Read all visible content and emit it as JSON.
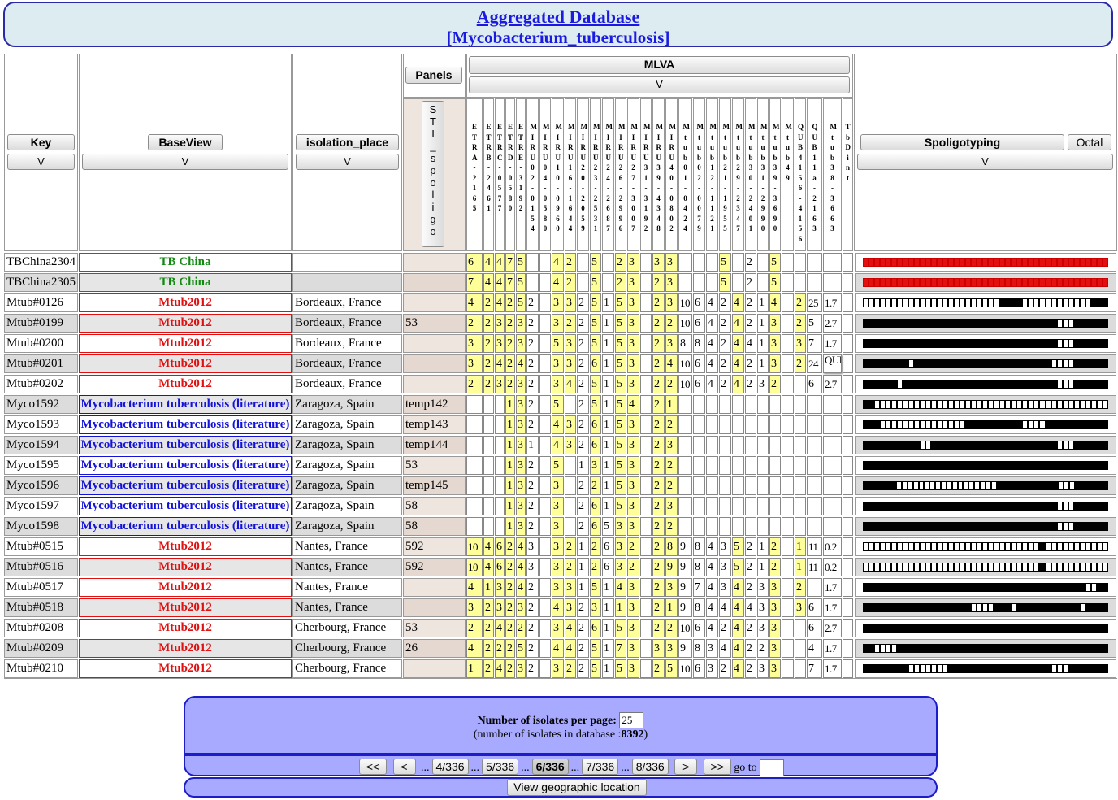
{
  "header": {
    "title": "Aggregated Database",
    "subtitle": "[Mycobacterium_tuberculosis]"
  },
  "columns": {
    "key": "Key",
    "baseview": "BaseView",
    "isolation_place": "isolation_place",
    "panels": "Panels",
    "mlva": "MLVA",
    "spoligotyping": "Spoligotyping",
    "octal": "Octal",
    "sort": "V",
    "sit_spoligo": [
      "S",
      "T",
      "I",
      "_",
      "s",
      "p",
      "o",
      "l",
      "i",
      "g",
      "o"
    ]
  },
  "mlva_headers": [
    "ETRA-2165",
    "ETRB-2461",
    "ETRC-0577",
    "ETRD-0580",
    "ETRE-3192",
    "MIRU02-0154",
    "MIRU04-0580",
    "MIRU10-0960",
    "MIRU16-1644",
    "MIRU20-2059",
    "MIRU23-2531",
    "MIRU24-2687",
    "MIRU26-2996",
    "MIRU27-3007",
    "MIRU31-3192",
    "MIRU39-4348",
    "MIRU40-0802",
    "Mtub01-0424",
    "Mtub02-0079",
    "Mtub12-1121",
    "Mtub21-1955",
    "Mtub29-2347",
    "Mtub30-2401",
    "Mtub31-2990",
    "Mtub39-3690",
    "Mtub49",
    "QUB4156-4156",
    "QUB11a-2163",
    "Mtub38-3663",
    "TbDint"
  ],
  "rows": [
    {
      "key": "TBChina2304",
      "base": "TB China",
      "color": "#128a12",
      "place": "",
      "panel": "",
      "mlva": [
        "6",
        "4",
        "4",
        "7",
        "5",
        "",
        "",
        "4",
        "2",
        "",
        "5",
        "",
        "2",
        "3",
        "",
        "3",
        "3",
        "",
        "",
        "",
        "5",
        "",
        "2",
        "",
        "5",
        "",
        "",
        "",
        "",
        ""
      ],
      "spoligo": "rrrrrrrrrrrrrrrrrrrrrrrrrrrrrrrrrrrrrrrrrrr"
    },
    {
      "key": "TBChina2305",
      "base": "TB China",
      "color": "#128a12",
      "place": "",
      "panel": "",
      "mlva": [
        "7",
        "4",
        "4",
        "7",
        "5",
        "",
        "",
        "4",
        "2",
        "",
        "5",
        "",
        "2",
        "3",
        "",
        "2",
        "3",
        "",
        "",
        "",
        "5",
        "",
        "2",
        "",
        "5",
        "",
        "",
        "",
        "",
        ""
      ],
      "spoligo": "rrrrrrrrrrrrrrrrrrrrrrrrrrrrrrrrrrrrrrrrrrr"
    },
    {
      "key": "Mtub#0126",
      "base": "Mtub2012",
      "color": "#e01010",
      "place": "Bordeaux, France",
      "panel": "",
      "mlva": [
        "4",
        "2",
        "4",
        "2",
        "5",
        "2",
        "",
        "3",
        "3",
        "2",
        "5",
        "1",
        "5",
        "3",
        "",
        "2",
        "3",
        "10",
        "6",
        "4",
        "2",
        "4",
        "2",
        "1",
        "4",
        "",
        "2",
        "25",
        "1.7",
        ""
      ],
      "spoligo": "eeeeeeeeeeeeeeeeeeeeeeeeffffeeeeeeeeeeeefff"
    },
    {
      "key": "Mtub#0199",
      "base": "Mtub2012",
      "color": "#e01010",
      "place": "Bordeaux, France",
      "panel": "53",
      "mlva": [
        "2",
        "2",
        "3",
        "2",
        "3",
        "2",
        "",
        "3",
        "2",
        "2",
        "5",
        "1",
        "5",
        "3",
        "",
        "2",
        "2",
        "10",
        "6",
        "4",
        "2",
        "4",
        "2",
        "1",
        "3",
        "",
        "2",
        "5",
        "2.7",
        ""
      ],
      "spoligo": "ffffffffffffffffffffffffffffffffffeeeffffff"
    },
    {
      "key": "Mtub#0200",
      "base": "Mtub2012",
      "color": "#e01010",
      "place": "Bordeaux, France",
      "panel": "",
      "mlva": [
        "3",
        "2",
        "3",
        "2",
        "3",
        "2",
        "",
        "5",
        "3",
        "2",
        "5",
        "1",
        "5",
        "3",
        "",
        "2",
        "3",
        "8",
        "8",
        "4",
        "2",
        "4",
        "4",
        "1",
        "3",
        "",
        "3",
        "7",
        "1.7",
        ""
      ],
      "spoligo": "ffffffffffffffffffffffffffffffffffeeeffffff"
    },
    {
      "key": "Mtub#0201",
      "base": "Mtub2012",
      "color": "#e01010",
      "place": "Bordeaux, France",
      "panel": "",
      "mlva": [
        "3",
        "2",
        "4",
        "2",
        "4",
        "2",
        "",
        "3",
        "3",
        "2",
        "6",
        "1",
        "5",
        "3",
        "",
        "2",
        "4",
        "10",
        "6",
        "4",
        "2",
        "4",
        "2",
        "1",
        "3",
        "",
        "2",
        "24",
        "QUE",
        ""
      ],
      "spoligo": "ffffffffeffffffffffffffffffffffffeeeeffffff"
    },
    {
      "key": "Mtub#0202",
      "base": "Mtub2012",
      "color": "#e01010",
      "place": "Bordeaux, France",
      "panel": "",
      "mlva": [
        "2",
        "2",
        "3",
        "2",
        "3",
        "2",
        "",
        "3",
        "4",
        "2",
        "5",
        "1",
        "5",
        "3",
        "",
        "2",
        "2",
        "10",
        "6",
        "4",
        "2",
        "4",
        "2",
        "3",
        "2",
        "",
        "",
        "6",
        "2.7",
        ""
      ],
      "spoligo": "ffffffefffffffffffffffffffffffffffeeeffffff"
    },
    {
      "key": "Myco1592",
      "base": "Mycobacterium tuberculosis (literature)",
      "color": "#1212d8",
      "place": "Zaragoza, Spain",
      "panel": "temp142",
      "mlva": [
        "",
        "",
        "",
        "1",
        "3",
        "2",
        "",
        "5",
        "",
        "2",
        "5",
        "1",
        "5",
        "4",
        "",
        "2",
        "1",
        "",
        "",
        "",
        "",
        "",
        "",
        "",
        "",
        "",
        "",
        "",
        "",
        ""
      ],
      "spoligo": "ffeeeeeeeeeeeeeeeeeeeeeeeeeeeeeeeeeeeeeeeee"
    },
    {
      "key": "Myco1593",
      "base": "Mycobacterium tuberculosis (literature)",
      "color": "#1212d8",
      "place": "Zaragoza, Spain",
      "panel": "temp143",
      "mlva": [
        "",
        "",
        "",
        "1",
        "3",
        "2",
        "",
        "4",
        "3",
        "2",
        "6",
        "1",
        "5",
        "3",
        "",
        "2",
        "2",
        "",
        "",
        "",
        "",
        "",
        "",
        "",
        "",
        "",
        "",
        "",
        "",
        ""
      ],
      "spoligo": "fffeeeeeeeeeeeeeeeffffffffffeeeefffffffffff"
    },
    {
      "key": "Myco1594",
      "base": "Mycobacterium tuberculosis (literature)",
      "color": "#1212d8",
      "place": "Zaragoza, Spain",
      "panel": "temp144",
      "mlva": [
        "",
        "",
        "",
        "1",
        "3",
        "1",
        "",
        "4",
        "3",
        "2",
        "6",
        "1",
        "5",
        "3",
        "",
        "2",
        "3",
        "",
        "",
        "",
        "",
        "",
        "",
        "",
        "",
        "",
        "",
        "",
        "",
        ""
      ],
      "spoligo": "ffffffffffeeffffffffffffffffffffffeeeffffff"
    },
    {
      "key": "Myco1595",
      "base": "Mycobacterium tuberculosis (literature)",
      "color": "#1212d8",
      "place": "Zaragoza, Spain",
      "panel": "53",
      "mlva": [
        "",
        "",
        "",
        "1",
        "3",
        "2",
        "",
        "5",
        "",
        "1",
        "3",
        "1",
        "5",
        "3",
        "",
        "2",
        "2",
        "",
        "",
        "",
        "",
        "",
        "",
        "",
        "",
        "",
        "",
        "",
        "",
        ""
      ],
      "spoligo": "fffffffffffffffffffffffffffffffffffffffffff"
    },
    {
      "key": "Myco1596",
      "base": "Mycobacterium tuberculosis (literature)",
      "color": "#1212d8",
      "place": "Zaragoza, Spain",
      "panel": "temp145",
      "mlva": [
        "",
        "",
        "",
        "1",
        "3",
        "2",
        "",
        "3",
        "",
        "2",
        "2",
        "1",
        "5",
        "3",
        "",
        "2",
        "2",
        "",
        "",
        "",
        "",
        "",
        "",
        "",
        "",
        "",
        "",
        "",
        "",
        ""
      ],
      "spoligo": "ffffffeeeeeeeeeeeeeeeeeefffffffffffeeeffffff"
    },
    {
      "key": "Myco1597",
      "base": "Mycobacterium tuberculosis (literature)",
      "color": "#1212d8",
      "place": "Zaragoza, Spain",
      "panel": "58",
      "mlva": [
        "",
        "",
        "",
        "1",
        "3",
        "2",
        "",
        "3",
        "",
        "2",
        "6",
        "1",
        "5",
        "3",
        "",
        "2",
        "3",
        "",
        "",
        "",
        "",
        "",
        "",
        "",
        "",
        "",
        "",
        "",
        "",
        ""
      ],
      "spoligo": "ffffffffffffffffffffffffffffffffffeeeffffff"
    },
    {
      "key": "Myco1598",
      "base": "Mycobacterium tuberculosis (literature)",
      "color": "#1212d8",
      "place": "Zaragoza, Spain",
      "panel": "58",
      "mlva": [
        "",
        "",
        "",
        "1",
        "3",
        "2",
        "",
        "3",
        "",
        "2",
        "6",
        "5",
        "3",
        "3",
        "",
        "2",
        "2",
        "",
        "",
        "",
        "",
        "",
        "",
        "",
        "",
        "",
        "",
        "",
        "",
        ""
      ],
      "spoligo": "ffffffffffffffffffffffffffffffffffeeeffffff"
    },
    {
      "key": "Mtub#0515",
      "base": "Mtub2012",
      "color": "#e01010",
      "place": "Nantes, France",
      "panel": "592",
      "mlva": [
        "10",
        "4",
        "6",
        "2",
        "4",
        "3",
        "",
        "3",
        "2",
        "1",
        "2",
        "6",
        "3",
        "2",
        "",
        "2",
        "8",
        "9",
        "8",
        "4",
        "3",
        "5",
        "2",
        "1",
        "2",
        "",
        "1",
        "11",
        "0.2",
        ""
      ],
      "spoligo": "eeeeeeeeeeeeeeeeeeeeeeeeeeeeeeefeeeeeeeeeee"
    },
    {
      "key": "Mtub#0516",
      "base": "Mtub2012",
      "color": "#e01010",
      "place": "Nantes, France",
      "panel": "592",
      "mlva": [
        "10",
        "4",
        "6",
        "2",
        "4",
        "3",
        "",
        "3",
        "2",
        "1",
        "2",
        "6",
        "3",
        "2",
        "",
        "2",
        "9",
        "9",
        "8",
        "4",
        "3",
        "5",
        "2",
        "1",
        "2",
        "",
        "1",
        "11",
        "0.2",
        ""
      ],
      "spoligo": "eeeeeeeeeeeeeeeeeeeeeeeeeeeeeeefeeeeeeeeeee"
    },
    {
      "key": "Mtub#0517",
      "base": "Mtub2012",
      "color": "#e01010",
      "place": "Nantes, France",
      "panel": "",
      "mlva": [
        "4",
        "1",
        "3",
        "2",
        "4",
        "2",
        "",
        "3",
        "3",
        "1",
        "5",
        "1",
        "4",
        "3",
        "",
        "2",
        "3",
        "9",
        "7",
        "4",
        "3",
        "4",
        "2",
        "3",
        "3",
        "",
        "2",
        "",
        "1.7",
        ""
      ],
      "spoligo": "fffffffffffffffffffffffffffffffffffffffeeff"
    },
    {
      "key": "Mtub#0518",
      "base": "Mtub2012",
      "color": "#e01010",
      "place": "Nantes, France",
      "panel": "",
      "mlva": [
        "3",
        "2",
        "3",
        "2",
        "3",
        "2",
        "",
        "4",
        "3",
        "2",
        "3",
        "1",
        "1",
        "3",
        "",
        "2",
        "1",
        "9",
        "8",
        "4",
        "4",
        "4",
        "4",
        "3",
        "3",
        "",
        "3",
        "6",
        "1.7",
        ""
      ],
      "spoligo": "fffffffffffffffffffeeeefffefffffffffffeffff"
    },
    {
      "key": "Mtub#0208",
      "base": "Mtub2012",
      "color": "#e01010",
      "place": "Cherbourg, France",
      "panel": "53",
      "mlva": [
        "2",
        "2",
        "4",
        "2",
        "2",
        "2",
        "",
        "3",
        "4",
        "2",
        "6",
        "1",
        "5",
        "3",
        "",
        "2",
        "2",
        "10",
        "6",
        "4",
        "2",
        "4",
        "2",
        "3",
        "3",
        "",
        "",
        "6",
        "2.7",
        ""
      ],
      "spoligo": "fffffffffffffffffffffffffffffffffffffffffff"
    },
    {
      "key": "Mtub#0209",
      "base": "Mtub2012",
      "color": "#e01010",
      "place": "Cherbourg, France",
      "panel": "26",
      "mlva": [
        "4",
        "2",
        "2",
        "2",
        "5",
        "2",
        "",
        "4",
        "4",
        "2",
        "5",
        "1",
        "7",
        "3",
        "",
        "3",
        "3",
        "9",
        "8",
        "3",
        "4",
        "4",
        "2",
        "2",
        "3",
        "",
        "",
        "4",
        "1.7",
        ""
      ],
      "spoligo": "ffeeeefffffffffffffffffffffffffffffffffffff"
    },
    {
      "key": "Mtub#0210",
      "base": "Mtub2012",
      "color": "#e01010",
      "place": "Cherbourg, France",
      "panel": "",
      "mlva": [
        "1",
        "2",
        "4",
        "2",
        "3",
        "2",
        "",
        "3",
        "2",
        "2",
        "5",
        "1",
        "5",
        "3",
        "",
        "2",
        "5",
        "10",
        "6",
        "3",
        "2",
        "4",
        "2",
        "3",
        "3",
        "",
        "",
        "7",
        "1.7",
        ""
      ],
      "spoligo": "ffffffffeeeeeeeffffffffffffffffffeeefffffff"
    }
  ],
  "pager": {
    "label": "Number of isolates per page:",
    "per_page": "25",
    "count_prefix": "(number of isolates in database :",
    "count": "8392",
    "count_suffix": ")",
    "first": "<<",
    "prev": "<",
    "ellipsis": "...",
    "pages": [
      "4/336",
      "5/336",
      "6/336",
      "7/336",
      "8/336"
    ],
    "next": ">",
    "last": ">>",
    "goto": "go to",
    "goto_value": "",
    "geo": "View geographic location"
  },
  "colors": {
    "yellow_cell": "#ffff99",
    "red_base": "#e01010",
    "green_base": "#128a12",
    "blue_base": "#1212d8",
    "border": "#1c1cc8"
  }
}
